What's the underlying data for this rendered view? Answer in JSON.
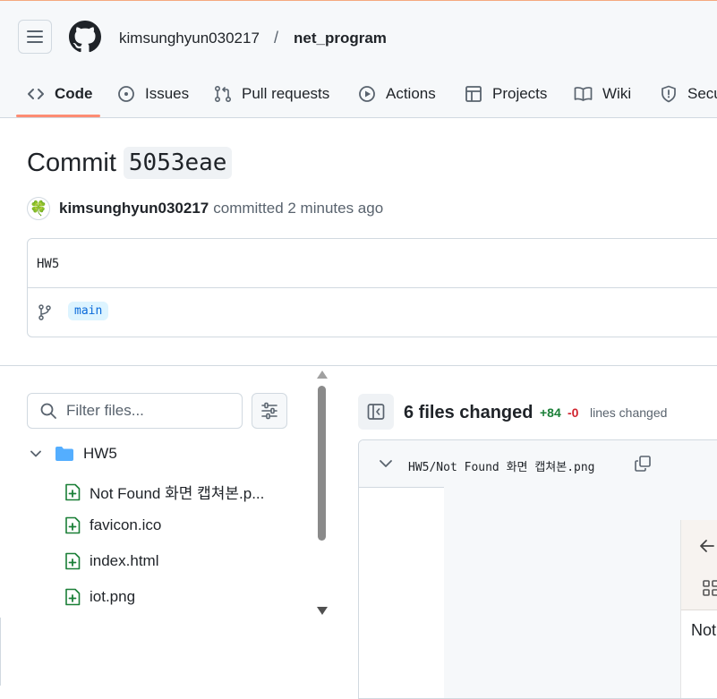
{
  "header": {
    "owner": "kimsunghyun030217",
    "separator": "/",
    "repo": "net_program",
    "tabs": [
      {
        "label": "Code",
        "icon": "code-icon",
        "active": true
      },
      {
        "label": "Issues",
        "icon": "issue-opened-icon"
      },
      {
        "label": "Pull requests",
        "icon": "git-pull-request-icon"
      },
      {
        "label": "Actions",
        "icon": "play-icon"
      },
      {
        "label": "Projects",
        "icon": "table-icon"
      },
      {
        "label": "Wiki",
        "icon": "book-icon"
      },
      {
        "label": "Secu",
        "icon": "shield-icon"
      }
    ]
  },
  "commit": {
    "title": "Commit",
    "sha": "5053eae",
    "avatar_emoji": "🍀",
    "author": "kimsunghyun030217",
    "rest": "committed 2 minutes ago",
    "message": "HW5",
    "branch": "main"
  },
  "file_tree": {
    "filter_placeholder": "Filter files...",
    "folder": "HW5",
    "files": [
      "Not Found 화면 캡쳐본.p...",
      "favicon.ico",
      "index.html",
      "iot.png"
    ]
  },
  "diff": {
    "files_changed": "6 files changed",
    "additions": "+84",
    "deletions": "-0",
    "lines_label": "lines changed",
    "file_path": "HW5/Not Found 화면 캡쳐본.png",
    "preview_text": "Not"
  },
  "colors": {
    "accent": "#fd8c73",
    "added": "#1a7f37",
    "deleted": "#d1242f",
    "link": "#0969da",
    "folder": "#54aeff"
  }
}
